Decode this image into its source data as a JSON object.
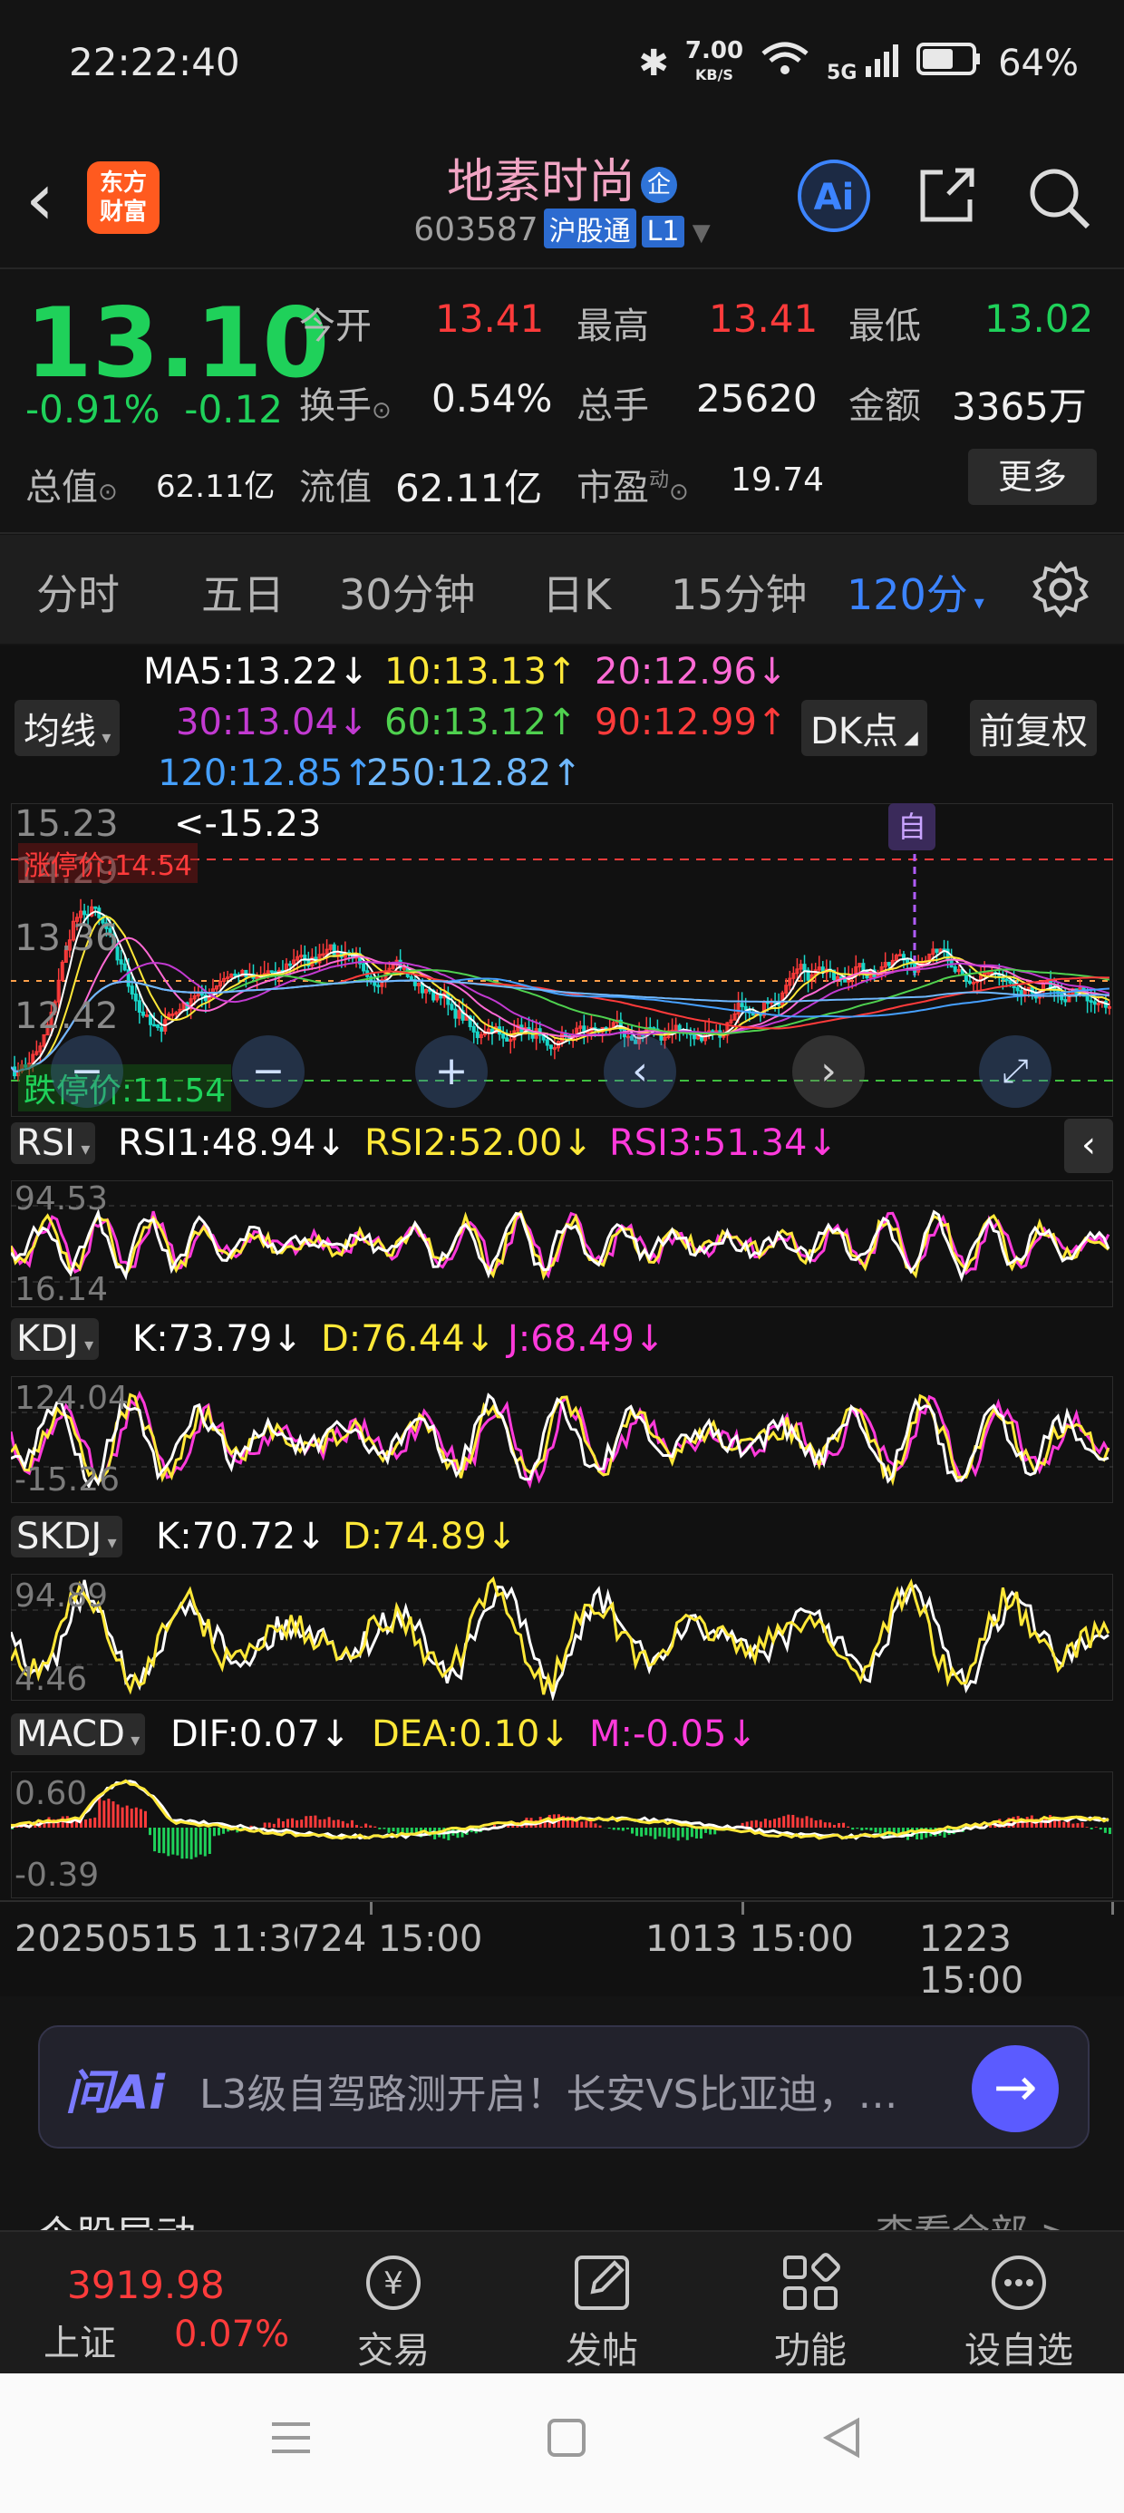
{
  "status": {
    "time": "22:22:40",
    "speed_top": "7.00",
    "speed_unit": "KB/S",
    "network": "5G",
    "battery": "64%",
    "battery_level": 0.64
  },
  "header": {
    "logo_line1": "东方",
    "logo_line2": "财富",
    "stock_name": "地素时尚",
    "badge": "企",
    "code": "603587",
    "tag1": "沪股通",
    "tag2": "L1",
    "ai_label": "Ai"
  },
  "quote": {
    "price": "13.10",
    "chg_pct": "-0.91%",
    "chg": "-0.12",
    "open_label": "今开",
    "open": "13.41",
    "high_label": "最高",
    "high": "13.41",
    "low_label": "最低",
    "low": "13.02",
    "turnover_label": "换手",
    "turnover": "0.54%",
    "volume_label": "总手",
    "volume": "25620",
    "amount_label": "金额",
    "amount": "3365万",
    "mcap_label": "总值",
    "mcap": "62.11亿",
    "float_label": "流值",
    "float": "62.11亿",
    "pe_label": "市盈",
    "pe_sup": "动",
    "pe": "19.74",
    "more": "更多"
  },
  "tabs": [
    {
      "label": "分时"
    },
    {
      "label": "五日"
    },
    {
      "label": "30分钟"
    },
    {
      "label": "日K"
    },
    {
      "label": "15分钟"
    },
    {
      "label": "120分"
    }
  ],
  "chart": {
    "ma_dropdown": "均线",
    "dk_button": "DK点",
    "fq_button": "前复权",
    "ma": [
      {
        "text": "MA5:13.22↓",
        "color": "#ffffff"
      },
      {
        "text": "10:13.13↑",
        "color": "#ffe838"
      },
      {
        "text": "20:12.96↓",
        "color": "#ff6ad5"
      },
      {
        "text": "30:13.04↓",
        "color": "#c23ad1"
      },
      {
        "text": "60:13.12↑",
        "color": "#4fd14f"
      },
      {
        "text": "90:12.99↑",
        "color": "#ff3b3b"
      },
      {
        "text": "120:12.85↑",
        "color": "#46a0ff"
      },
      {
        "text": "250:12.82↑",
        "color": "#6fb8ff"
      }
    ],
    "y_labels": [
      "15.23",
      "14.29",
      "13.36",
      "12.42"
    ],
    "high_marker": "<-15.23",
    "limit_up": "涨停价:14.54",
    "limit_down_marker": "跌停价:11.54",
    "self_tag": "自",
    "rsi": {
      "name": "RSI",
      "rsi1": "RSI1:48.94↓",
      "rsi2": "RSI2:52.00↓",
      "rsi3": "RSI3:51.34↓",
      "top": "94.53",
      "bottom": "16.14"
    },
    "kdj": {
      "name": "KDJ",
      "k": "K:73.79↓",
      "d": "D:76.44↓",
      "j": "J:68.49↓",
      "top": "124.04",
      "bottom": "-15.26"
    },
    "skdj": {
      "name": "SKDJ",
      "k": "K:70.72↓",
      "d": "D:74.89↓",
      "top": "94.89",
      "bottom": "4.46"
    },
    "macd": {
      "name": "MACD",
      "dif": "DIF:0.07↓",
      "dea": "DEA:0.10↓",
      "m": "M:-0.05↓",
      "top": "0.60",
      "bottom": "-0.39"
    },
    "dates": [
      "20250515 11:30",
      "724 15:00",
      "1013 15:00",
      "1223 15:00"
    ]
  },
  "ai_banner": {
    "label": "问Ai",
    "text": "L3级自驾路测开启！长安VS比亚迪，…"
  },
  "peek": {
    "left": "个股异动",
    "right": "查看全部 >"
  },
  "bottom_nav": {
    "index_value": "3919.98",
    "index_name": "上证",
    "index_chg": "0.07%",
    "trade": "交易",
    "post": "发帖",
    "func": "功能",
    "watch": "设自选"
  }
}
